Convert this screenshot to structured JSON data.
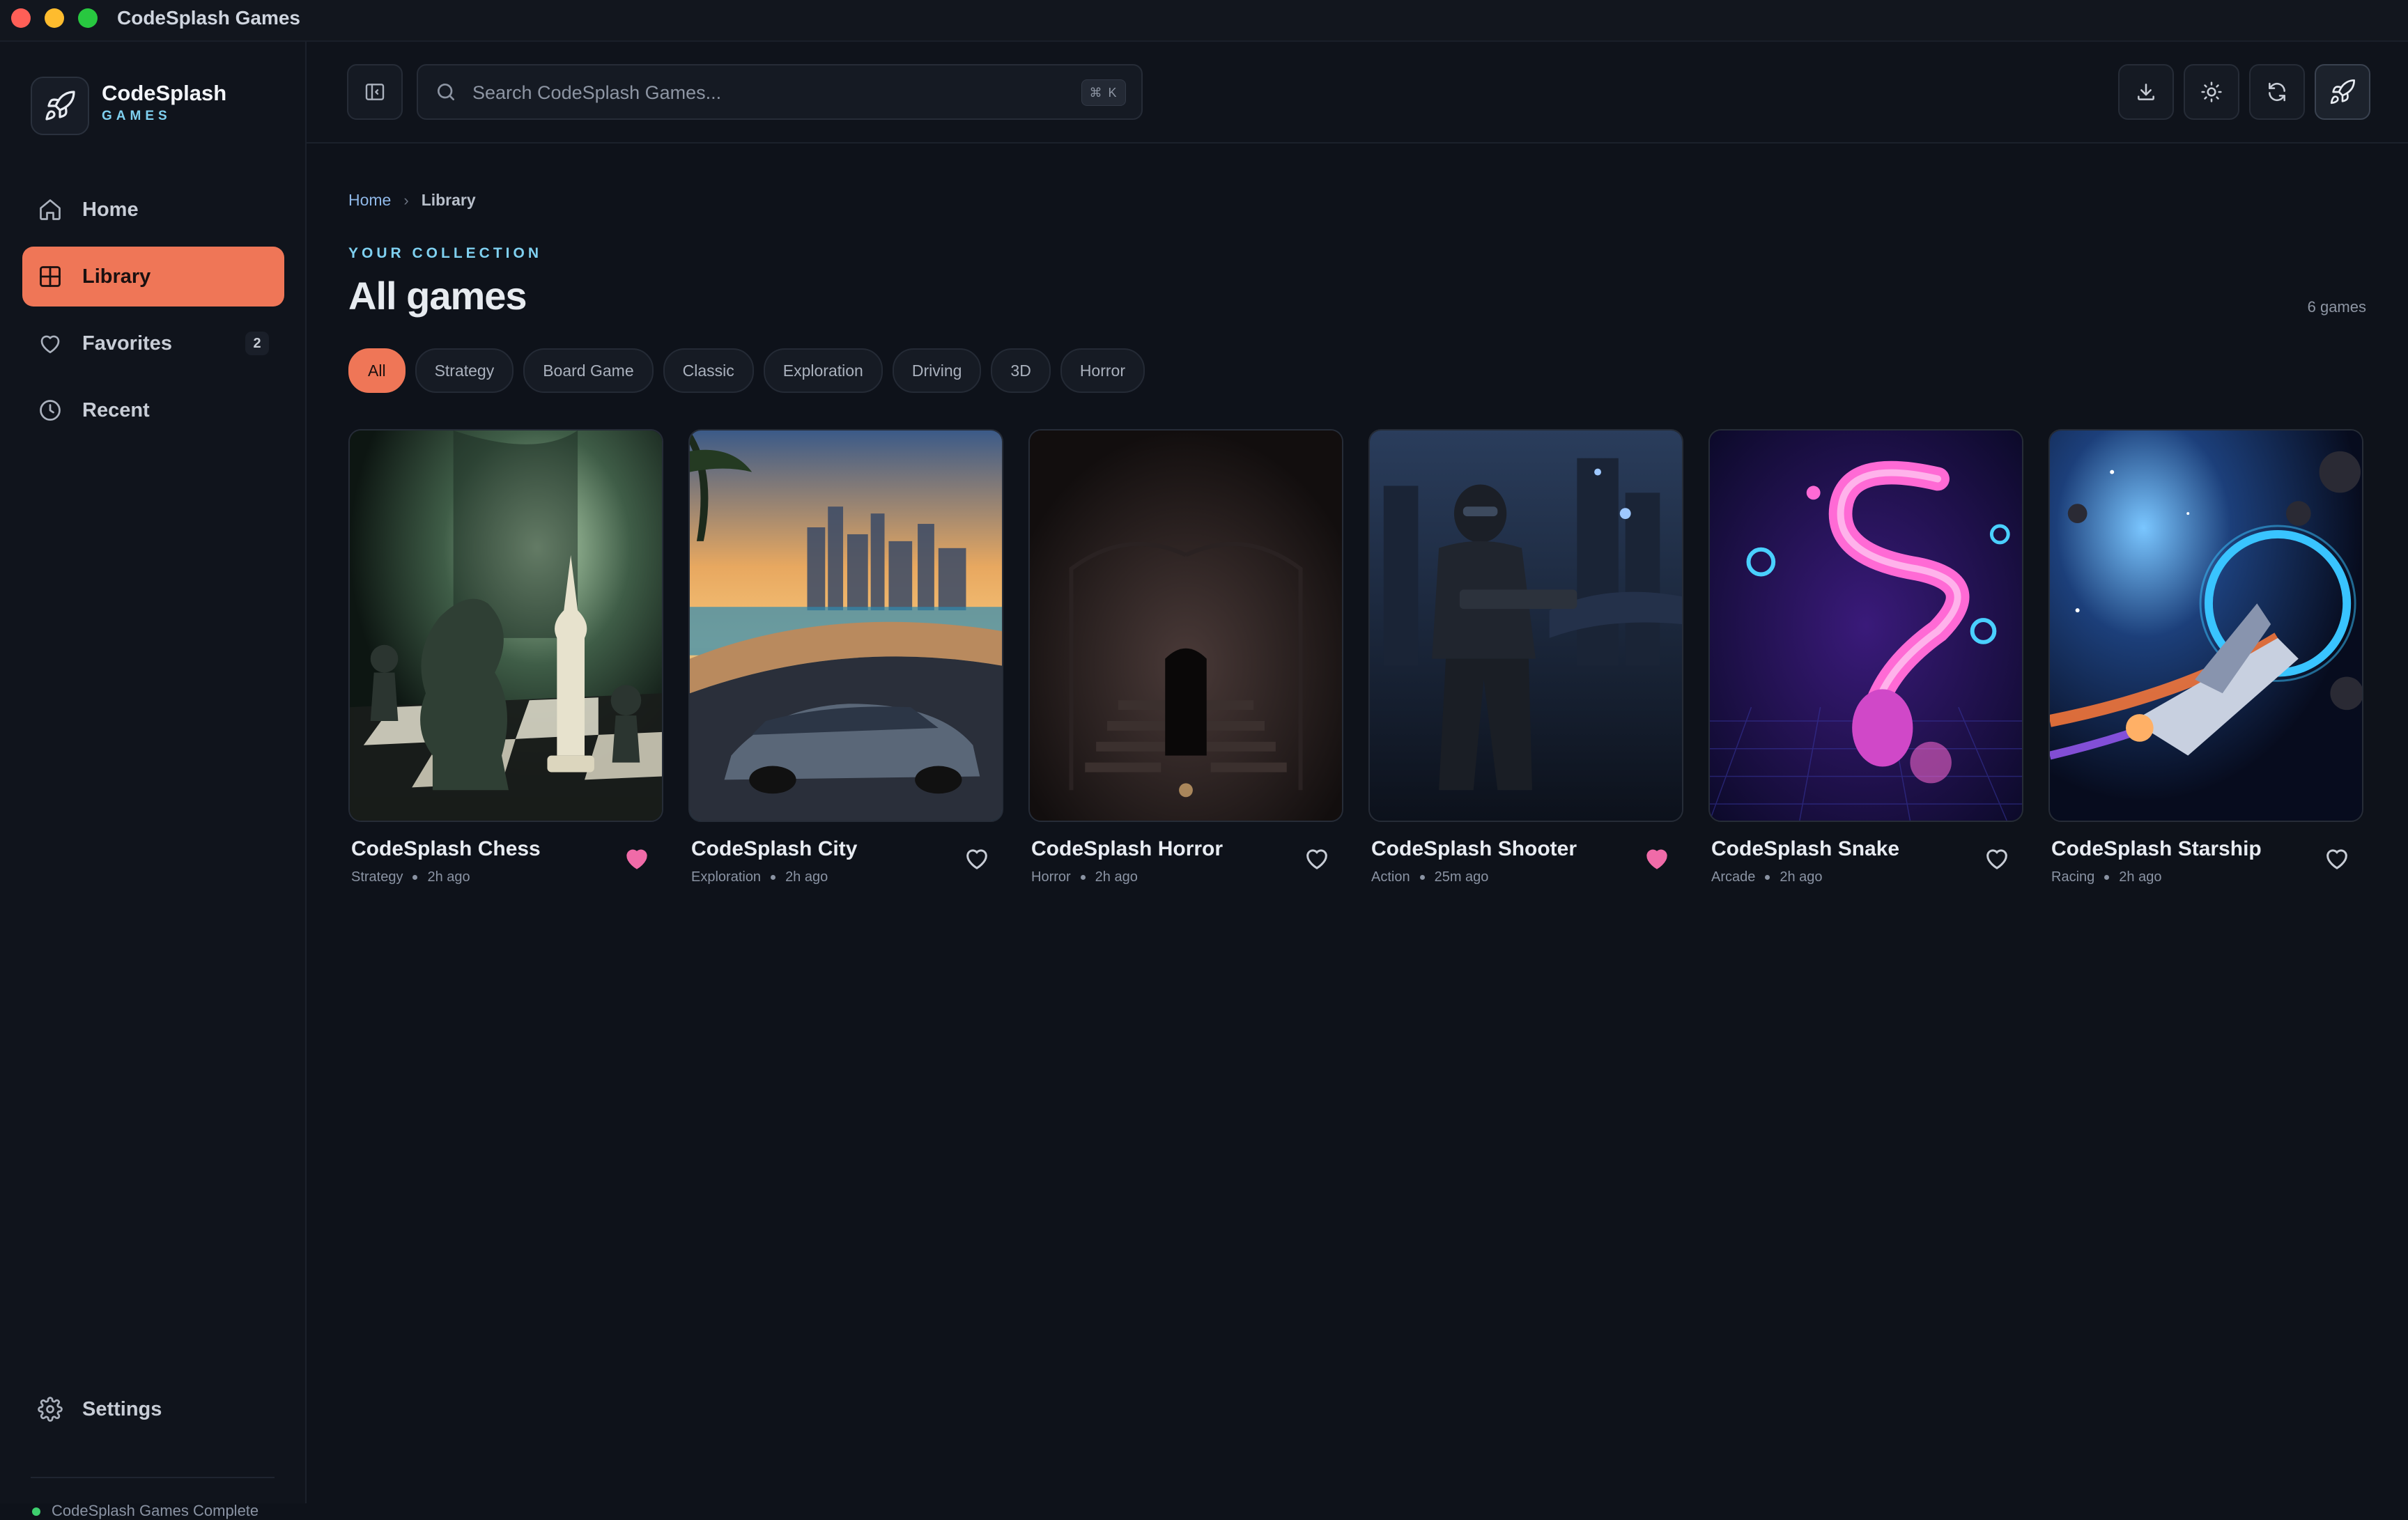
{
  "window": {
    "title": "CodeSplash Games"
  },
  "brand": {
    "name": "CodeSplash",
    "sub": "GAMES"
  },
  "sidebar": {
    "items": [
      {
        "label": "Home",
        "icon": "home-icon"
      },
      {
        "label": "Library",
        "icon": "grid-icon",
        "active": true
      },
      {
        "label": "Favorites",
        "icon": "heart-icon",
        "badge": "2"
      },
      {
        "label": "Recent",
        "icon": "clock-icon"
      }
    ],
    "settings_label": "Settings",
    "status_text": "CodeSplash Games Complete"
  },
  "search": {
    "placeholder": "Search CodeSplash Games...",
    "shortcut": "⌘ K"
  },
  "toolbar": {
    "icons": [
      "download-icon",
      "sun-icon",
      "refresh-icon",
      "rocket-icon"
    ]
  },
  "breadcrumb": {
    "home": "Home",
    "current": "Library"
  },
  "header": {
    "eyebrow": "YOUR COLLECTION",
    "title": "All games",
    "count": "6 games"
  },
  "filters": [
    "All",
    "Strategy",
    "Board Game",
    "Classic",
    "Exploration",
    "Driving",
    "3D",
    "Horror"
  ],
  "active_filter": "All",
  "games": [
    {
      "title": "CodeSplash Chess",
      "genre": "Strategy",
      "time": "2h ago",
      "favorite": true,
      "art": "chess"
    },
    {
      "title": "CodeSplash City",
      "genre": "Exploration",
      "time": "2h ago",
      "favorite": false,
      "art": "city"
    },
    {
      "title": "CodeSplash Horror",
      "genre": "Horror",
      "time": "2h ago",
      "favorite": false,
      "art": "horror"
    },
    {
      "title": "CodeSplash Shooter",
      "genre": "Action",
      "time": "25m ago",
      "favorite": true,
      "art": "shooter"
    },
    {
      "title": "CodeSplash Snake",
      "genre": "Arcade",
      "time": "2h ago",
      "favorite": false,
      "art": "snake"
    },
    {
      "title": "CodeSplash Starship",
      "genre": "Racing",
      "time": "2h ago",
      "favorite": false,
      "art": "starship"
    }
  ],
  "colors": {
    "accent": "#ef7657",
    "favorite": "#f06ba8",
    "cyan": "#7fd0f0",
    "background": "#0e121a"
  }
}
